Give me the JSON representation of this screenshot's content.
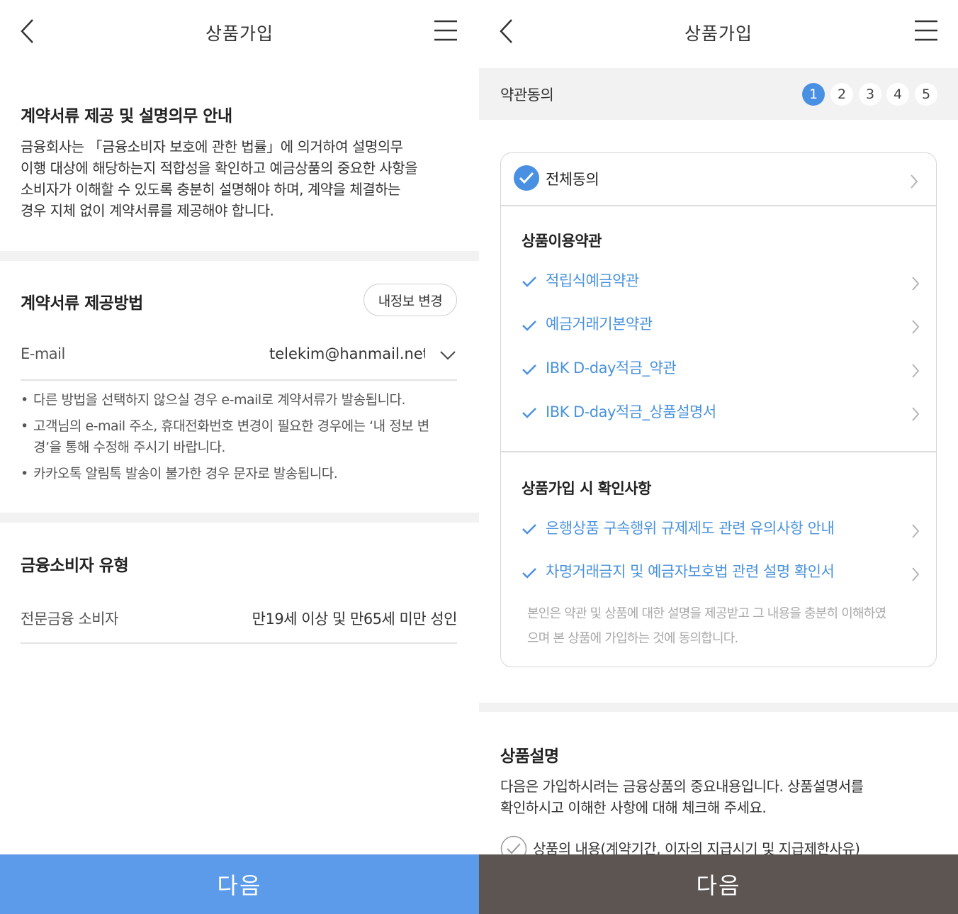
{
  "left": {
    "header": {
      "title": "상품가입"
    },
    "notice": {
      "title": "계약서류 제공 및 설명의무 안내",
      "lines": [
        "금융회사는 「금융소비자 보호에 관한 법률」에 의거하여 설명의무",
        "이행 대상에 해당하는지 적합성을 확인하고 예금상품의 중요한 사항을",
        "소비자가 이해할 수 있도록 충분히 설명해야 하며, 계약을 체결하는",
        "경우 지체 없이 계약서류를 제공해야 합니다."
      ]
    },
    "delivery": {
      "title": "계약서류 제공방법",
      "change_button": "내정보 변경",
      "email_label": "E-mail",
      "email_value": "telekim@hanmail.net",
      "notes": [
        "다른 방법을 선택하지 않으실 경우 e-mail로 계약서류가 발송됩니다.",
        "고객님의 e-mail 주소, 휴대전화번호 변경이 필요한 경우에는 ‘내 정보 변",
        "경’을 통해 수정해 주시기 바랍니다.",
        "카카오톡 알림톡 발송이 불가한 경우 문자로 발송됩니다."
      ]
    },
    "consumer": {
      "title": "금융소비자 유형",
      "label": "전문금융 소비자",
      "value": "만19세 이상 및 만65세 미만 성인"
    },
    "next_button": "다음"
  },
  "right": {
    "header": {
      "title": "상품가입"
    },
    "step_bar": {
      "label": "약관동의",
      "steps": [
        "1",
        "2",
        "3",
        "4",
        "5"
      ],
      "active": 0
    },
    "agree_all": "전체동의",
    "terms_section": {
      "title": "상품이용약관",
      "items": [
        "적립식예금약관",
        "예금거래기본약관",
        "IBK D-day적금_약관",
        "IBK D-day적금_상품설명서"
      ]
    },
    "confirm_section": {
      "title": "상품가입 시 확인사항",
      "items": [
        "은행상품 구속행위 규제제도 관련 유의사항 안내",
        "차명거래금지 및 예금자보호법 관련 설명 확인서"
      ],
      "note_lines": [
        "본인은 약관 및 상품에 대한 설명을 제공받고 그 내용을 충분히 이해하였",
        "으며 본 상품에 가입하는 것에 동의합니다."
      ]
    },
    "product_desc": {
      "title": "상품설명",
      "lines": [
        "다음은 가입하시려는 금융상품의 중요내용입니다. 상품설명서를",
        "확인하시고 이해한 사항에 대해 체크해 주세요."
      ],
      "first_item": "상품의 내용(계약기간, 이자의 지급시기 및 지급제한사유)"
    },
    "next_button": "다음"
  },
  "colors": {
    "accent_blue": "#4a90e2",
    "link_blue": "#4a93dc",
    "left_button": "#5b9bea",
    "right_button": "#5c5552"
  }
}
